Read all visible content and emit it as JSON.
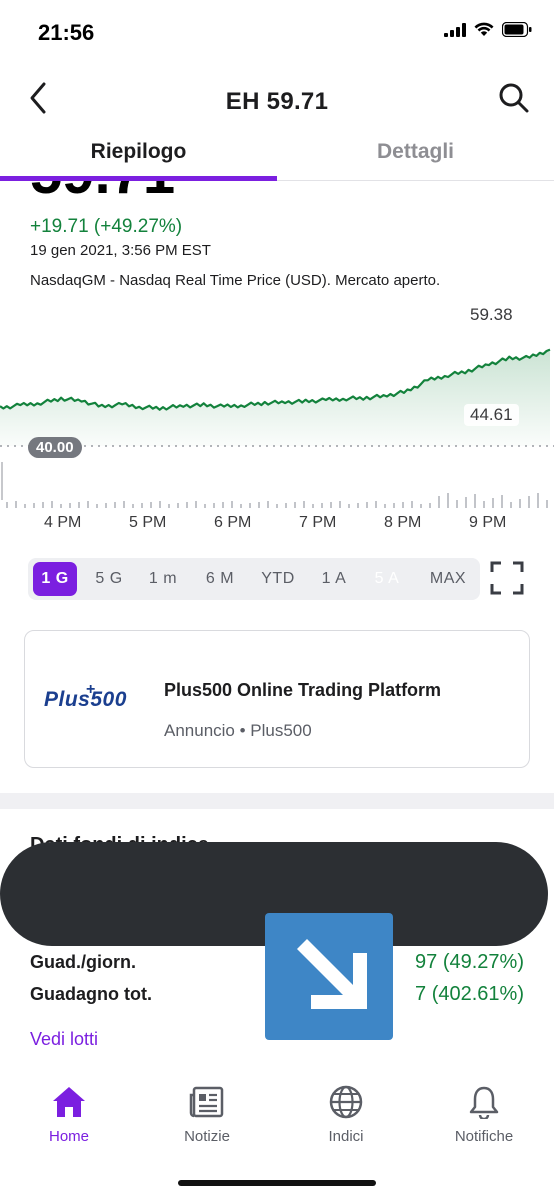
{
  "status_bar": {
    "time": "21:56"
  },
  "header": {
    "title": "EH 59.71",
    "back_icon": "chevron-left-icon",
    "search_icon": "search-icon"
  },
  "tabs": [
    {
      "label": "Riepilogo",
      "active": true
    },
    {
      "label": "Dettagli",
      "active": false
    }
  ],
  "quote": {
    "price": "59.71",
    "change": "+19.71 (+49.27%)",
    "timestamp": "19 gen 2021, 3:56 PM EST",
    "exchange_note": "NasdaqGM - Nasdaq Real Time Price (USD). Mercato aperto.",
    "change_color": "#13823c"
  },
  "chart_data": {
    "type": "area",
    "high_label": "59.38",
    "low_label": "44.61",
    "previous_close_label": "40.00",
    "x_ticks": [
      "4 PM",
      "5 PM",
      "6 PM",
      "7 PM",
      "8 PM",
      "9 PM"
    ],
    "x": [
      "3:30 PM",
      "3:45 PM",
      "3:55 PM",
      "4:00 PM",
      "4:15 PM",
      "4:30 PM",
      "4:45 PM",
      "5:00 PM",
      "5:15 PM",
      "5:30 PM",
      "5:45 PM",
      "6:00 PM",
      "6:15 PM",
      "6:30 PM",
      "6:45 PM",
      "7:00 PM",
      "7:15 PM",
      "7:30 PM",
      "7:45 PM",
      "8:00 PM",
      "8:10 PM",
      "8:20 PM",
      "8:30 PM",
      "8:45 PM",
      "9:00 PM",
      "9:15 PM",
      "9:30 PM",
      "9:40 PM"
    ],
    "values": [
      45.2,
      45.6,
      45.9,
      46.5,
      46.2,
      45.4,
      45.7,
      45.3,
      45.2,
      45.5,
      45.6,
      45.4,
      45.6,
      45.9,
      46.0,
      46.1,
      46.3,
      46.5,
      46.6,
      46.9,
      47.5,
      49.0,
      49.7,
      50.3,
      51.2,
      52.0,
      52.1,
      53.2
    ],
    "line_color": "#13823c"
  },
  "range_selector": {
    "options": [
      {
        "label": "1 G",
        "state": "active"
      },
      {
        "label": "5 G",
        "state": "normal"
      },
      {
        "label": "1 m",
        "state": "normal"
      },
      {
        "label": "6 M",
        "state": "normal"
      },
      {
        "label": "YTD",
        "state": "normal"
      },
      {
        "label": "1 A",
        "state": "normal"
      },
      {
        "label": "5 A",
        "state": "disabled"
      },
      {
        "label": "MAX",
        "state": "normal"
      }
    ],
    "accent": "#7b1fe0"
  },
  "ad": {
    "logo_text": "Plus500",
    "title": "Plus500 Online Trading Platform",
    "meta": "Annuncio  •  Plus500"
  },
  "portfolio": {
    "title": "Dati fondi di indice",
    "rows": [
      {
        "label": "Guad./giorn.",
        "value": "97 (49.27%)"
      },
      {
        "label": "Guadagno tot.",
        "value": "7 (402.61%)"
      }
    ],
    "see_lots": "Vedi lotti"
  },
  "bottom_nav": [
    {
      "label": "Home",
      "icon": "home-icon",
      "active": true
    },
    {
      "label": "Notizie",
      "icon": "newspaper-icon",
      "active": false
    },
    {
      "label": "Indici",
      "icon": "globe-icon",
      "active": false
    },
    {
      "label": "Notifiche",
      "icon": "bell-icon",
      "active": false
    }
  ]
}
